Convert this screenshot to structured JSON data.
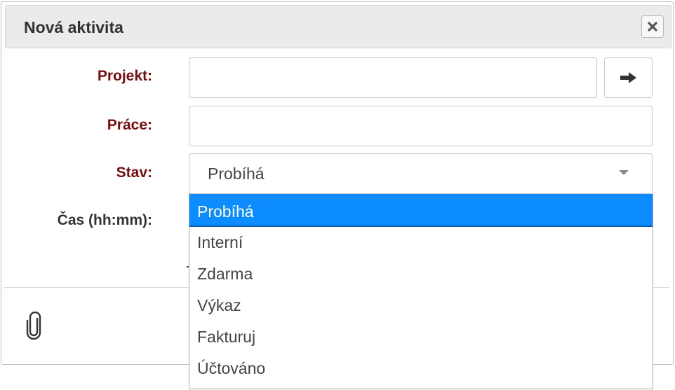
{
  "dialog": {
    "title": "Nová aktivita",
    "close_icon": "close-x-icon"
  },
  "form": {
    "projekt_label": "Projekt:",
    "projekt_value": "",
    "prace_label": "Práce:",
    "prace_value": "",
    "stav_label": "Stav:",
    "stav_value": "Probíhá",
    "cas_label": "Čas (hh:mm):",
    "arrow_icon": "arrow-right-icon"
  },
  "dropdown": {
    "options": [
      "Probíhá",
      "Interní",
      "Zdarma",
      "Výkaz",
      "Fakturuj",
      "Účtováno"
    ],
    "selected_index": 0,
    "highlight_color": "#0d8cff"
  },
  "footer": {
    "attachment_icon": "paperclip-icon"
  },
  "colors": {
    "required_label": "#7a0d0d",
    "plain_label": "#333333"
  }
}
